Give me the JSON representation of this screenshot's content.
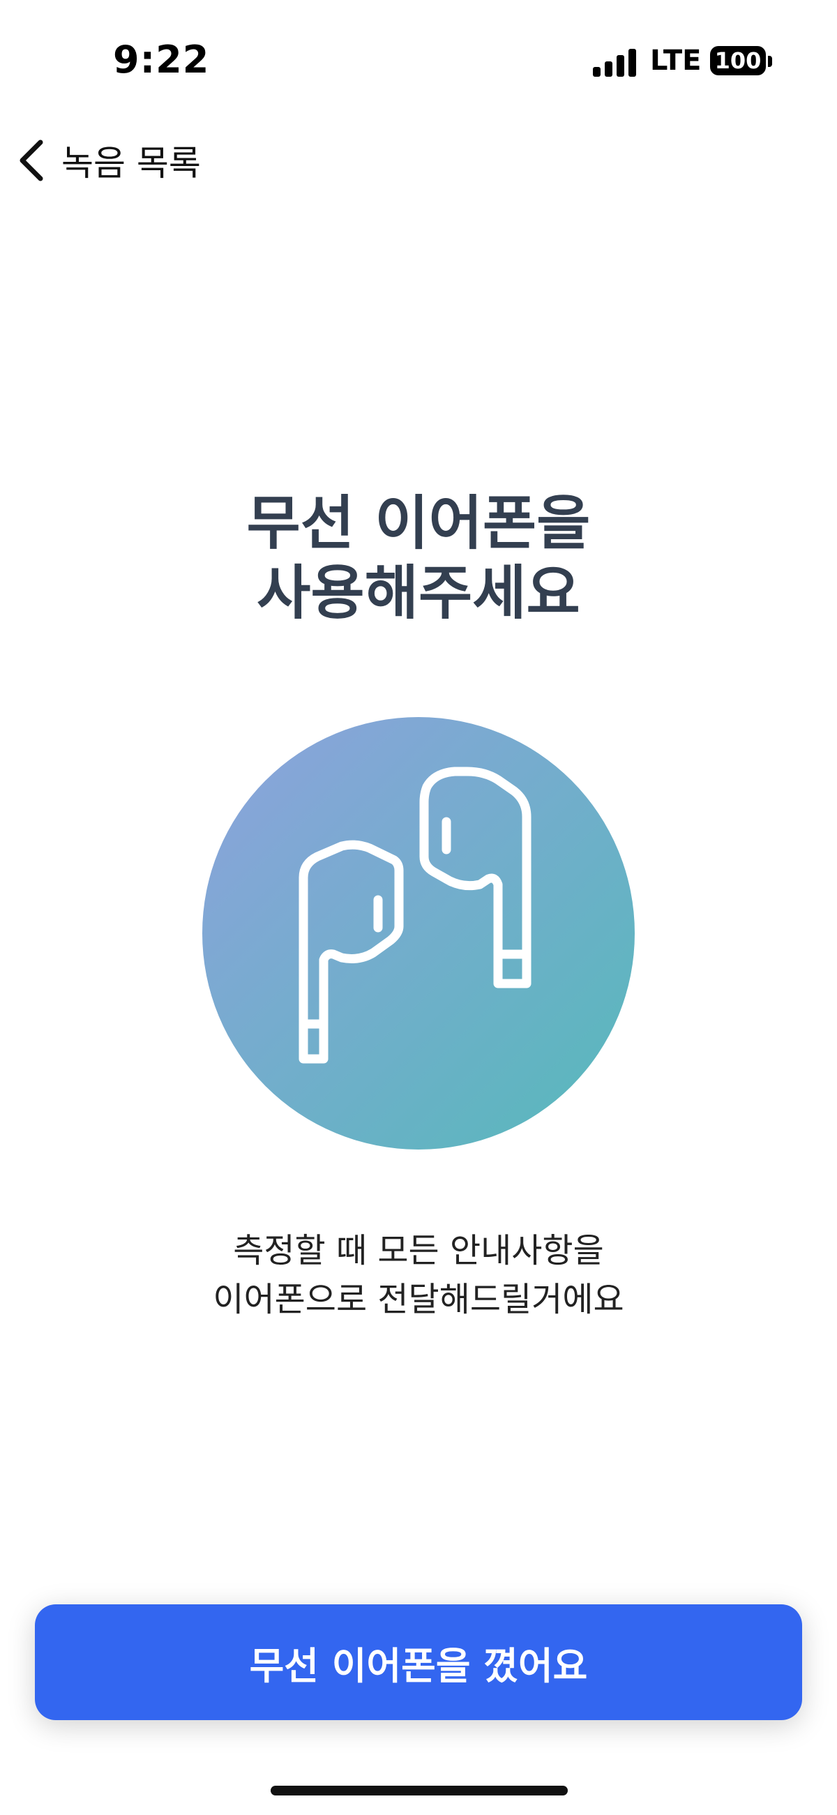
{
  "status_bar": {
    "time": "9:22",
    "network": "LTE",
    "battery": "100"
  },
  "nav": {
    "back_label": "녹음 목록"
  },
  "main": {
    "title_line1": "무선 이어폰을",
    "title_line2": "사용해주세요",
    "illustration_icon": "earbuds-icon",
    "description_line1": "측정할 때 모든 안내사항을",
    "description_line2": "이어폰으로 전달해드릴거에요"
  },
  "footer": {
    "confirm_label": "무선 이어폰을 꼈어요"
  },
  "colors": {
    "accent": "#3366f0",
    "title": "#333f50",
    "gradient_start": "#879fd9",
    "gradient_end": "#5bb8bd"
  }
}
